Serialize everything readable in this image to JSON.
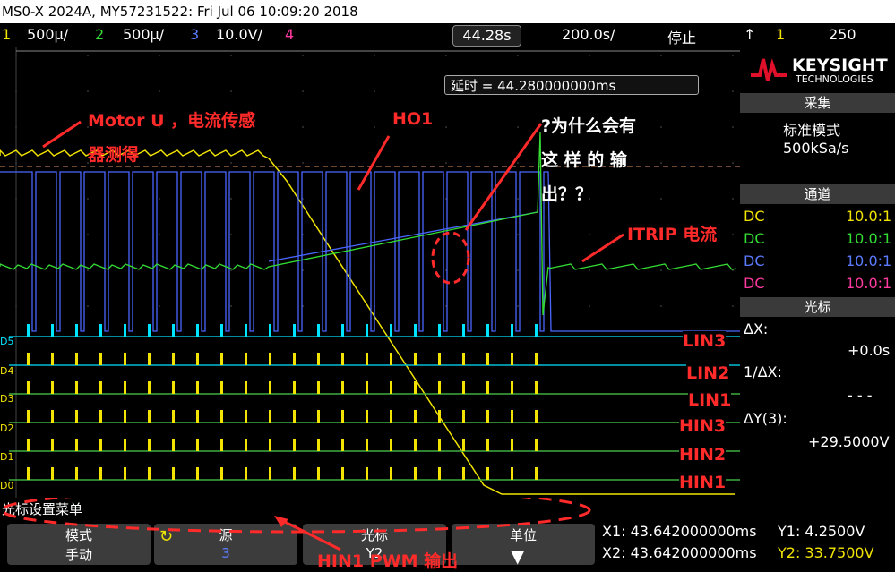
{
  "title": "MS0-X 2024A, MY57231522: Fri Jul 06 10:09:20 2018",
  "channels": [
    {
      "num": "1",
      "scale": "500µ/",
      "color": "#f2e400"
    },
    {
      "num": "2",
      "scale": "500µ/",
      "color": "#33dd33"
    },
    {
      "num": "3",
      "scale": "10.0V/",
      "color": "#5b7bff"
    },
    {
      "num": "4",
      "scale": "",
      "color": "#ff3aa0"
    }
  ],
  "timebar": {
    "delay": "44.28s",
    "timebase": "200.0s/",
    "run_state": "停止",
    "trig_ch": "1",
    "trig_level": "250"
  },
  "delay_box": "延时 = 44.280000000ms",
  "brand": {
    "name": "KEYSIGHT",
    "sub": "TECHNOLOGIES"
  },
  "acq": {
    "header": "采集",
    "mode": "标准模式",
    "rate": "500kSa/s"
  },
  "chan_panel": {
    "header": "通道",
    "rows": [
      {
        "coupling": "DC",
        "ratio": "10.0:1",
        "color": "#f2e400"
      },
      {
        "coupling": "DC",
        "ratio": "10.0:1",
        "color": "#33dd33"
      },
      {
        "coupling": "DC",
        "ratio": "10.0:1",
        "color": "#5b7bff"
      },
      {
        "coupling": "DC",
        "ratio": "10.0:1",
        "color": "#ff3aa0"
      }
    ]
  },
  "cursor_panel": {
    "header": "光标",
    "dx_label": "ΔX:",
    "dx": "+0.0s",
    "inv_dx_label": "1/ΔX:",
    "inv_dx": "- - -",
    "dy_label": "ΔY(3):",
    "dy": "+29.5000V"
  },
  "annotations": {
    "motor_u_1": "Motor U ，电流传感",
    "motor_u_2": "器测得",
    "ho1": "HO1",
    "question_1": "?为什么会有",
    "question_2": "这 样 的 输",
    "question_3": "出？？",
    "itrip": "ITRIP 电流",
    "hin1_pwm": "HIN1 PWM 输出"
  },
  "digital_labels": [
    "LIN3",
    "LIN2",
    "LIN1",
    "HIN3",
    "HIN2",
    "HIN1"
  ],
  "digital_markers": [
    "D5",
    "D4",
    "D3",
    "D2",
    "D1",
    "D0"
  ],
  "menu_title": "光标设置菜单",
  "softkeys": [
    {
      "top": "模式",
      "bottom": "手动"
    },
    {
      "top": "源",
      "bottom": "3"
    },
    {
      "top": "光标",
      "bottom": "Y2"
    },
    {
      "top": "单位",
      "bottom": ""
    }
  ],
  "readouts": {
    "x1": "X1: 43.642000000ms",
    "x2": "X2: 43.642000000ms",
    "y1": "Y1: 4.2500V",
    "y2": "Y2: 33.7500V"
  }
}
